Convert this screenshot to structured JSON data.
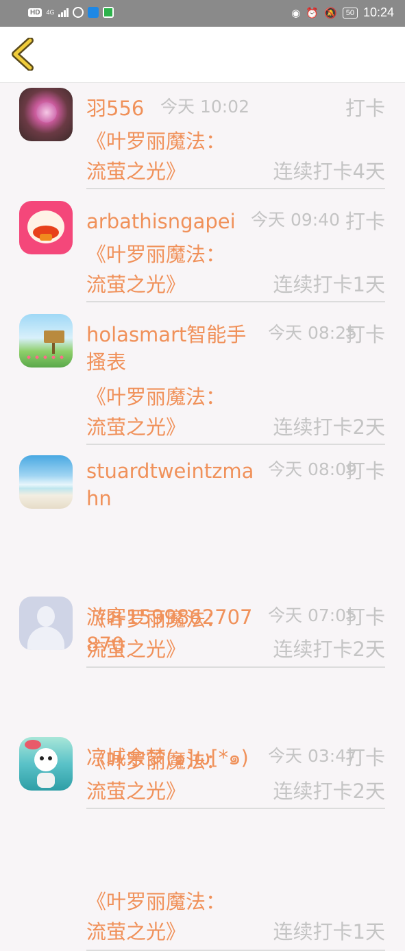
{
  "status_bar": {
    "hd": "HD",
    "network": "4G",
    "battery": "50",
    "time": "10:24"
  },
  "nav": {
    "back_icon": "chevron-left-icon"
  },
  "colors": {
    "accent": "#f0915a",
    "muted": "#c4c4c4",
    "back_icon": "#e8c13a"
  },
  "items": [
    {
      "name": "羽556",
      "time": "今天 10:02",
      "action": "打卡",
      "book_line1": "《叶罗丽魔法：",
      "book_line2": "流萤之光》",
      "streak": "连续打卡4天",
      "avatar": "flower-bouquet-avatar"
    },
    {
      "name": "arbathisngapei",
      "time": "今天 09:40",
      "action": "打卡",
      "book_line1": "《叶罗丽魔法：",
      "book_line2": "流萤之光》",
      "streak": "连续打卡1天",
      "avatar": "red-fox-cartoon-avatar"
    },
    {
      "name": "holasmart智能手搔表",
      "time": "今天 08:25",
      "action": "打卡",
      "book_line1": "《叶罗丽魔法：",
      "book_line2": "流萤之光》",
      "streak": "连续打卡2天",
      "avatar": "garden-signboard-avatar"
    },
    {
      "name": "stuardtweintzmahn",
      "time": "今天 08:09",
      "action": "打卡",
      "book_line1": "《叶罗丽魔法：",
      "book_line2": "流萤之光》",
      "streak": "连续打卡2天",
      "avatar": "beach-sky-avatar"
    },
    {
      "name": "游客1599862707870",
      "time": "今天 07:05",
      "action": "打卡",
      "book_line1": "《叶罗丽魔法：",
      "book_line2": "流萤之光》",
      "streak": "连续打卡2天",
      "avatar": "default-user-avatar"
    },
    {
      "name": "凉城余梦(๑]ω[*๑)",
      "time": "今天 03:47",
      "action": "打卡",
      "book_line1": "《叶罗丽魔法：",
      "book_line2": "流萤之光》",
      "streak": "连续打卡1天",
      "avatar": "cartoon-character-avatar"
    }
  ]
}
